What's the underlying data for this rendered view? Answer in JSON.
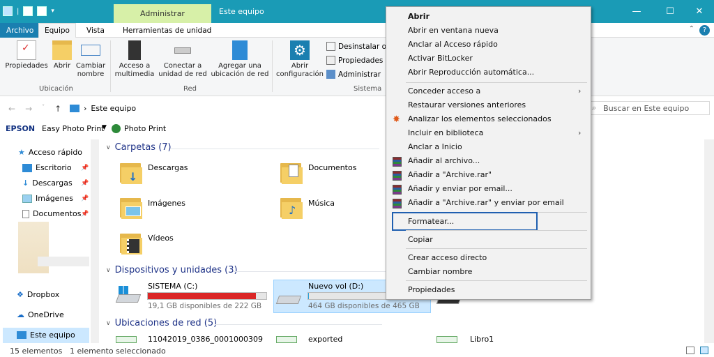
{
  "titlebar": {
    "context_tab": "Administrar",
    "title": "Este equipo",
    "minimize_icon": "minimize-icon",
    "maximize_icon": "maximize-icon",
    "close_icon": "close-icon"
  },
  "ribbon_tabs": {
    "archivo": "Archivo",
    "equipo": "Equipo",
    "vista": "Vista",
    "herramientas": "Herramientas de unidad"
  },
  "ribbon": {
    "propiedades": "Propiedades",
    "abrir": "Abrir",
    "cambiar_nombre": "Cambiar nombre",
    "ubicacion_group": "Ubicación",
    "acceso_multimedia": "Acceso a multimedia",
    "conectar_unidad": "Conectar a unidad de red",
    "agregar_ubicacion": "Agregar una ubicación de red",
    "red_group": "Red",
    "abrir_configuracion": "Abrir configuración",
    "desinstalar": "Desinstalar o c",
    "propiedades_del": "Propiedades d",
    "administrar": "Administrar",
    "sistema_group": "Sistema"
  },
  "address": {
    "path": "Este equipo",
    "search_placeholder": "Buscar en Este equipo"
  },
  "epson": {
    "brand": "EPSON",
    "app": "Easy Photo Print",
    "photo_print": "Photo Print"
  },
  "sidebar": {
    "quick_access": "Acceso rápido",
    "items": [
      {
        "label": "Escritorio"
      },
      {
        "label": "Descargas"
      },
      {
        "label": "Imágenes"
      },
      {
        "label": "Documentos"
      }
    ],
    "dropbox": "Dropbox",
    "onedrive": "OneDrive",
    "este_equipo": "Este equipo"
  },
  "main": {
    "carpetas_header": "Carpetas (7)",
    "folders": [
      {
        "name": "Descargas"
      },
      {
        "name": "Documentos"
      },
      {
        "name": "Imágenes"
      },
      {
        "name": "Música"
      },
      {
        "name": "Vídeos"
      }
    ],
    "dispositivos_header": "Dispositivos y unidades (3)",
    "drives": [
      {
        "name": "SISTEMA (C:)",
        "free": "19,1 GB disponibles de 222 GB",
        "used_fraction": 0.914,
        "bar_color": "#da2626"
      },
      {
        "name": "Nuevo vol (D:)",
        "free": "464 GB disponibles de 465 GB",
        "used_fraction": 0.002,
        "bar_color": "#26a0da"
      }
    ],
    "ubicaciones_header": "Ubicaciones de red (5)",
    "network": [
      {
        "name": "11042019_0386_0001000309"
      },
      {
        "name": "exported"
      },
      {
        "name": "Libro1"
      }
    ]
  },
  "status": {
    "count": "15 elementos",
    "selected": "1 elemento seleccionado"
  },
  "context_menu": {
    "items": [
      "Abrir",
      "Abrir en ventana nueva",
      "Anclar al Acceso rápido",
      "Activar BitLocker",
      "Abrir Reproducción automática...",
      "Conceder acceso a",
      "Restaurar versiones anteriores",
      "Analizar los elementos seleccionados",
      "Incluir en biblioteca",
      "Anclar a Inicio",
      "Añadir al archivo...",
      "Añadir a \"Archive.rar\"",
      "Añadir y enviar por email...",
      "Añadir a \"Archive.rar\" y enviar por email",
      "Formatear...",
      "Copiar",
      "Crear acceso directo",
      "Cambiar nombre",
      "Propiedades"
    ]
  },
  "colors": {
    "titlebar": "#1a9bb6",
    "context_tab": "#d7f0a8",
    "archivo_tab": "#1a7fb0",
    "highlight_border": "#1f5fb0",
    "selected_drive_bg": "#cce8ff"
  }
}
